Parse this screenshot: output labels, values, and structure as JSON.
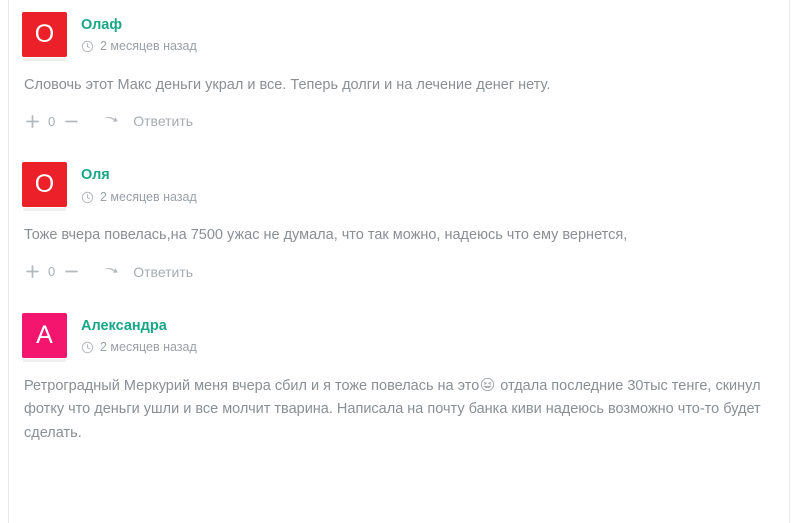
{
  "theme": {
    "author_name_color": "#18a689",
    "body_text_color": "#8a8f94",
    "meta_text_color": "#9aa0a6",
    "action_text_color": "#a7acb1",
    "page_background": "#ffffff",
    "edge_rule_color": "#e9ecef"
  },
  "comments": [
    {
      "avatar": {
        "initial": "O",
        "color": "#ec2028",
        "name": "avatar-olaf"
      },
      "author": "Олаф",
      "time_icon": "clock-icon",
      "time": "2 месяцев назад",
      "body": "Словочь этот Макс деньги украл и все. Теперь долги и на лечение денег нету.",
      "actions": {
        "upvote_icon": "plus-icon",
        "vote_count": "0",
        "downvote_icon": "minus-icon",
        "reply_icon": "reply-arrow-icon",
        "reply_label": "Ответить"
      }
    },
    {
      "avatar": {
        "initial": "O",
        "color": "#ec2028",
        "name": "avatar-olya"
      },
      "author": "Оля",
      "time_icon": "clock-icon",
      "time": "2 месяцев назад",
      "body": "Тоже вчера повелась,на 7500 ужас не думала, что так можно, надеюсь что ему вернется,",
      "actions": {
        "upvote_icon": "plus-icon",
        "vote_count": "0",
        "downvote_icon": "minus-icon",
        "reply_icon": "reply-arrow-icon",
        "reply_label": "Ответить"
      }
    },
    {
      "avatar": {
        "initial": "A",
        "color": "#f4156f",
        "name": "avatar-aleksandra"
      },
      "author": "Александра",
      "time_icon": "clock-icon",
      "time": "2 месяцев назад",
      "body_before_emoji": "Ретроградный Меркурий меня вчера сбил и я тоже повелась на это",
      "body_emoji": "grinning-squinting-face-emoji",
      "body_after_emoji": " отдала последние 30тыс тенге, скинул фотку что деньги ушли и все молчит тварина. Написала на почту банка киви надеюсь возможно что-то будет сделать.",
      "actions": null
    }
  ]
}
